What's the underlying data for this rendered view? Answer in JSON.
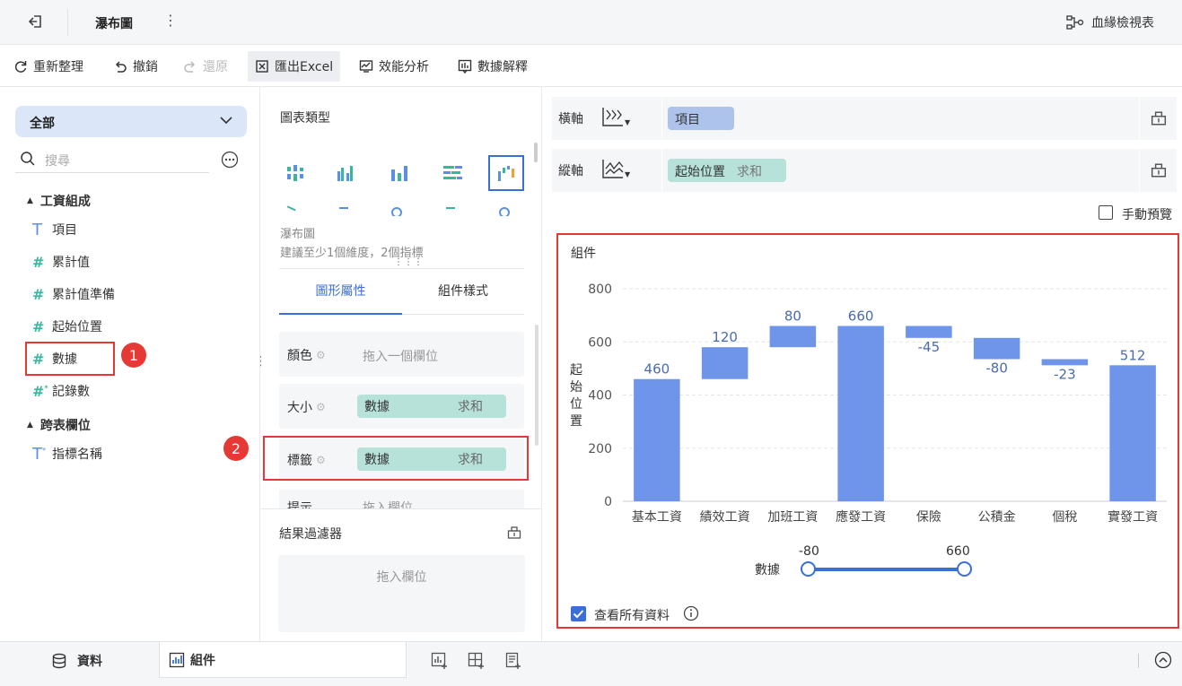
{
  "topbar": {
    "title": "瀑布圖",
    "lineage": "血緣檢視表"
  },
  "toolbar": {
    "refresh": "重新整理",
    "undo": "撤銷",
    "redo": "還原",
    "export": "匯出Excel",
    "perf": "效能分析",
    "explain": "數據解釋"
  },
  "left": {
    "dropdown": "全部",
    "search_placeholder": "搜尋",
    "group1": "工資組成",
    "fields": [
      "項目",
      "累計值",
      "累計值準備",
      "起始位置",
      "數據",
      "記錄數"
    ],
    "group2": "跨表欄位",
    "cross_fields": [
      "指標名稱"
    ]
  },
  "mid": {
    "chart_type_title": "圖表類型",
    "chart_name": "瀑布圖",
    "chart_hint": "建議至少1個維度，2個指標",
    "tab_graph": "圖形屬性",
    "tab_style": "組件樣式",
    "color_label": "顏色",
    "color_placeholder": "拖入一個欄位",
    "size_label": "大小",
    "size_field": "數據",
    "size_agg": "求和",
    "label_label": "標籤",
    "label_field": "數據",
    "label_agg": "求和",
    "next_label": "提示",
    "next_placeholder": "拖入欄位",
    "filter_title": "結果過濾器",
    "filter_placeholder": "拖入欄位"
  },
  "right": {
    "x_axis_label": "橫軸",
    "x_axis_field": "項目",
    "y_axis_label": "縱軸",
    "y_axis_field": "起始位置",
    "y_axis_agg": "求和",
    "manual_preview": "手動預覽",
    "widget_title": "組件",
    "view_all": "查看所有資料",
    "slider_label": "數據",
    "slider_min": "-80",
    "slider_max": "660"
  },
  "annotations": {
    "badge1": "1",
    "badge2": "2"
  },
  "bottom": {
    "data_tab": "資料",
    "widget_tab": "組件"
  },
  "chart_data": {
    "type": "bar",
    "subtype": "waterfall",
    "ylabel": "起始位置",
    "ylim": [
      0,
      800
    ],
    "yticks": [
      "0",
      "200",
      "400",
      "600",
      "800"
    ],
    "categories": [
      "基本工資",
      "績效工資",
      "加班工資",
      "應發工資",
      "保險",
      "公積金",
      "個稅",
      "實發工資"
    ],
    "starts": [
      0,
      460,
      580,
      0,
      660,
      615,
      535,
      0
    ],
    "values": [
      460,
      120,
      80,
      660,
      -45,
      -80,
      -23,
      512
    ],
    "labels": [
      "460",
      "120",
      "80",
      "660",
      "-45",
      "-80",
      "-23",
      "512"
    ],
    "color": "#6f95ea",
    "grid": true
  }
}
